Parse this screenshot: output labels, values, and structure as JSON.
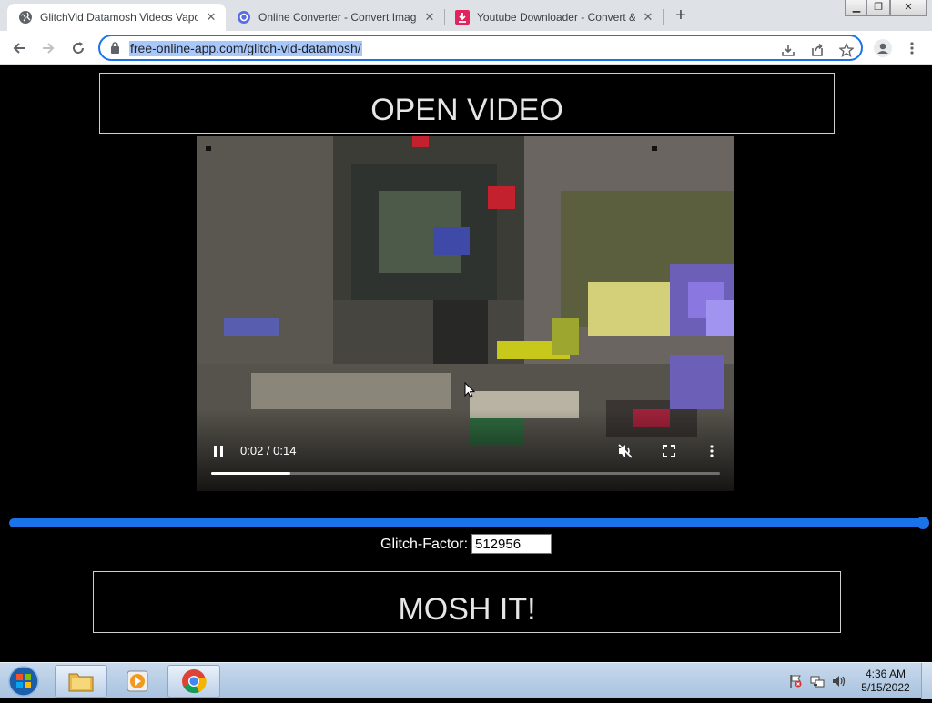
{
  "browser": {
    "tabs": [
      {
        "title": "GlitchVid Datamosh Videos Vapo",
        "active": true,
        "favicon": "globe-icon"
      },
      {
        "title": "Online Converter - Convert Imag",
        "active": false,
        "favicon": "converter-icon"
      },
      {
        "title": "Youtube Downloader - Convert &",
        "active": false,
        "favicon": "download-icon"
      }
    ],
    "url": "free-online-app.com/glitch-vid-datamosh/",
    "accent": "#1a73e8"
  },
  "page": {
    "open_button": "OPEN VIDEO",
    "mosh_button": "MOSH IT!",
    "glitch_label": "Glitch-Factor:",
    "glitch_value": "512956",
    "slider_level": 1.0
  },
  "video": {
    "time": "0:02 / 0:14",
    "progress": 0.155,
    "muted": true,
    "playing": true
  },
  "taskbar": {
    "time": "4:36 AM",
    "date": "5/15/2022"
  }
}
